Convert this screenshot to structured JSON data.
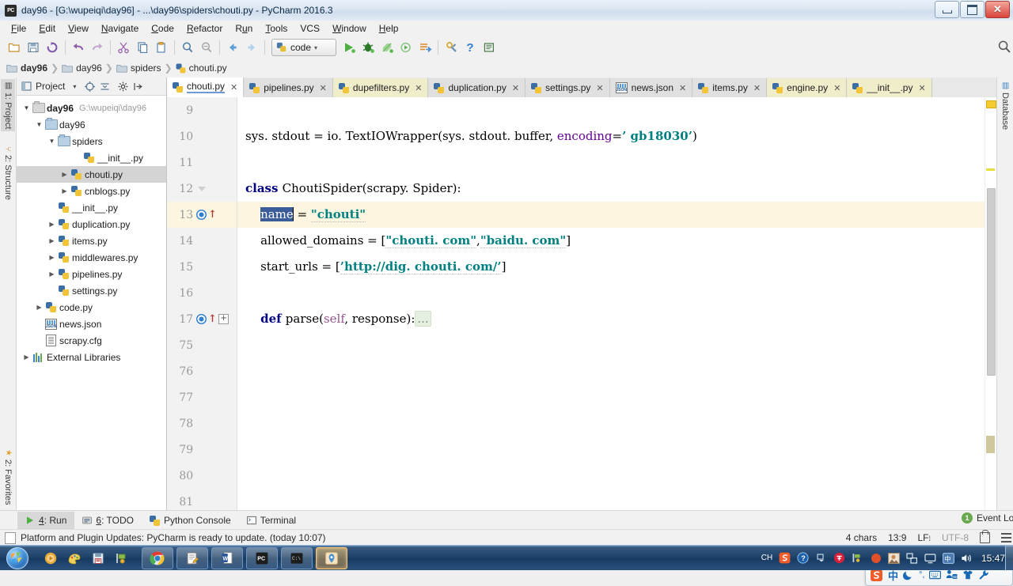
{
  "window": {
    "title": "day96 - [G:\\wupeiqi\\day96] - ...\\day96\\spiders\\chouti.py - PyCharm 2016.3",
    "app_icon": "PC",
    "minimize": "−",
    "maximize": "□",
    "close": "✕"
  },
  "menu": [
    {
      "label": "File",
      "accel": "F"
    },
    {
      "label": "Edit",
      "accel": "E"
    },
    {
      "label": "View",
      "accel": "V"
    },
    {
      "label": "Navigate",
      "accel": "N"
    },
    {
      "label": "Code",
      "accel": "C"
    },
    {
      "label": "Refactor",
      "accel": "R"
    },
    {
      "label": "Run",
      "accel": "u"
    },
    {
      "label": "Tools",
      "accel": "T"
    },
    {
      "label": "VCS",
      "accel": ""
    },
    {
      "label": "Window",
      "accel": "W"
    },
    {
      "label": "Help",
      "accel": "H"
    }
  ],
  "toolbar": {
    "run_config": "code",
    "buttons": [
      "open-folder-icon",
      "save-all-icon",
      "sync-icon",
      "undo-icon",
      "redo-icon",
      "cut-icon",
      "copy-icon",
      "paste-icon",
      "find-icon",
      "replace-icon",
      "back-icon",
      "forward-icon"
    ],
    "run_buttons": [
      "run-icon",
      "debug-icon",
      "coverage-icon",
      "profile-icon",
      "run-with-console-icon"
    ],
    "settings_label": "settings-icon",
    "help_label": "help-icon",
    "search_everywhere": "search-everywhere-icon"
  },
  "breadcrumb": [
    {
      "label": "day96",
      "icon": "folder-icon",
      "bold": true
    },
    {
      "label": "day96",
      "icon": "folder-icon",
      "bold": false
    },
    {
      "label": "spiders",
      "icon": "folder-icon",
      "bold": false
    },
    {
      "label": "chouti.py",
      "icon": "python-file-icon",
      "bold": false
    }
  ],
  "left_strip": [
    {
      "label": "1: Project",
      "accel": "1",
      "selected": true,
      "icon": "project-icon"
    },
    {
      "label": "2: Structure",
      "accel": "7",
      "selected": false,
      "icon": "structure-icon"
    },
    {
      "label": "2: Favorites",
      "accel": "2",
      "selected": false,
      "icon": "star-icon"
    }
  ],
  "right_strip": [
    {
      "label": "Database",
      "icon": "database-icon"
    }
  ],
  "project_pane": {
    "title": "Project",
    "header_icons": [
      "chevron-down-icon",
      "target-icon",
      "collapse-all-icon",
      "settings-gear-icon",
      "hide-icon"
    ],
    "tree": [
      {
        "indent": 0,
        "twisty": "open",
        "icon": "folder-icon",
        "label": "day96",
        "bold": true,
        "path": "G:\\wupeiqi\\day96",
        "selected": false
      },
      {
        "indent": 1,
        "twisty": "open",
        "icon": "folder-blue-icon",
        "label": "day96",
        "bold": false,
        "path": "",
        "selected": false
      },
      {
        "indent": 2,
        "twisty": "open",
        "icon": "folder-blue-icon",
        "label": "spiders",
        "bold": false,
        "path": "",
        "selected": false
      },
      {
        "indent": 4,
        "twisty": "none",
        "icon": "python-file-icon",
        "label": "__init__.py",
        "bold": false,
        "path": "",
        "selected": false
      },
      {
        "indent": 3,
        "twisty": "closed",
        "icon": "python-file-icon",
        "label": "chouti.py",
        "bold": false,
        "path": "",
        "selected": true
      },
      {
        "indent": 3,
        "twisty": "closed",
        "icon": "python-file-icon",
        "label": "cnblogs.py",
        "bold": false,
        "path": "",
        "selected": false
      },
      {
        "indent": 2,
        "twisty": "none",
        "icon": "python-file-icon",
        "label": "__init__.py",
        "bold": false,
        "path": "",
        "selected": false
      },
      {
        "indent": 2,
        "twisty": "closed",
        "icon": "python-file-icon",
        "label": "duplication.py",
        "bold": false,
        "path": "",
        "selected": false
      },
      {
        "indent": 2,
        "twisty": "closed",
        "icon": "python-file-icon",
        "label": "items.py",
        "bold": false,
        "path": "",
        "selected": false
      },
      {
        "indent": 2,
        "twisty": "closed",
        "icon": "python-file-icon",
        "label": "middlewares.py",
        "bold": false,
        "path": "",
        "selected": false
      },
      {
        "indent": 2,
        "twisty": "closed",
        "icon": "python-file-icon",
        "label": "pipelines.py",
        "bold": false,
        "path": "",
        "selected": false
      },
      {
        "indent": 2,
        "twisty": "none",
        "icon": "python-file-icon",
        "label": "settings.py",
        "bold": false,
        "path": "",
        "selected": false
      },
      {
        "indent": 1,
        "twisty": "closed",
        "icon": "python-file-icon",
        "label": "code.py",
        "bold": false,
        "path": "",
        "selected": false
      },
      {
        "indent": 1,
        "twisty": "none",
        "icon": "json-file-icon",
        "label": "news.json",
        "bold": false,
        "path": "",
        "selected": false
      },
      {
        "indent": 1,
        "twisty": "none",
        "icon": "cfg-file-icon",
        "label": "scrapy.cfg",
        "bold": false,
        "path": "",
        "selected": false
      },
      {
        "indent": 0,
        "twisty": "closed",
        "icon": "libraries-icon",
        "label": "External Libraries",
        "bold": false,
        "path": "",
        "selected": false
      }
    ]
  },
  "editor": {
    "tabs": [
      {
        "label": "chouti.py",
        "icon": "python-file-icon",
        "active": true,
        "modified": false
      },
      {
        "label": "pipelines.py",
        "icon": "python-file-icon",
        "active": false,
        "modified": false
      },
      {
        "label": "dupefilters.py",
        "icon": "python-file-icon",
        "active": false,
        "modified": true
      },
      {
        "label": "duplication.py",
        "icon": "python-file-icon",
        "active": false,
        "modified": false
      },
      {
        "label": "settings.py",
        "icon": "python-file-icon",
        "active": false,
        "modified": false
      },
      {
        "label": "news.json",
        "icon": "json-file-icon",
        "active": false,
        "modified": false
      },
      {
        "label": "items.py",
        "icon": "python-file-icon",
        "active": false,
        "modified": false
      },
      {
        "label": "engine.py",
        "icon": "python-file-icon",
        "active": false,
        "modified": true
      },
      {
        "label": "__init__.py",
        "icon": "python-file-icon",
        "active": false,
        "modified": true
      }
    ],
    "tab_close": "✕",
    "lines": [
      {
        "num": "9",
        "current": false,
        "override": false,
        "fold": "none",
        "tokens": []
      },
      {
        "num": "10",
        "current": false,
        "override": false,
        "fold": "none",
        "tokens": [
          {
            "t": "sys. stdout = io. TextIOWrapper(sys. stdout. buffer,",
            "c": "plain"
          },
          {
            "t": " encoding",
            "c": "named"
          },
          {
            "t": "=",
            "c": "plain"
          },
          {
            "t": "’ gb18030’",
            "c": "str"
          },
          {
            "t": ")",
            "c": "plain"
          }
        ]
      },
      {
        "num": "11",
        "current": false,
        "override": false,
        "fold": "none",
        "tokens": []
      },
      {
        "num": "12",
        "current": false,
        "override": false,
        "fold": "tri",
        "tokens": [
          {
            "t": "class ",
            "c": "kw"
          },
          {
            "t": "ChoutiSpider(scrapy. Spider):",
            "c": "plain"
          }
        ]
      },
      {
        "num": "13",
        "current": true,
        "override": true,
        "fold": "none",
        "tokens": [
          {
            "t": "    ",
            "c": "plain"
          },
          {
            "t": "name",
            "c": "sel"
          },
          {
            "t": " = ",
            "c": "plain"
          },
          {
            "t": "\"chouti\"",
            "c": "str-u"
          }
        ]
      },
      {
        "num": "14",
        "current": false,
        "override": false,
        "fold": "none",
        "tokens": [
          {
            "t": "    allowed_domains = [",
            "c": "plain"
          },
          {
            "t": "\"chouti. com\"",
            "c": "str-u"
          },
          {
            "t": ",",
            "c": "plain"
          },
          {
            "t": "\"baidu. com\"",
            "c": "str-u"
          },
          {
            "t": "]",
            "c": "plain"
          }
        ]
      },
      {
        "num": "15",
        "current": false,
        "override": false,
        "fold": "none",
        "tokens": [
          {
            "t": "    start_urls = [",
            "c": "plain"
          },
          {
            "t": "’http://dig. chouti. com/’",
            "c": "str-u"
          },
          {
            "t": "]",
            "c": "plain"
          }
        ]
      },
      {
        "num": "16",
        "current": false,
        "override": false,
        "fold": "none",
        "tokens": []
      },
      {
        "num": "17",
        "current": false,
        "override": true,
        "fold": "plus",
        "tokens": [
          {
            "t": "    ",
            "c": "plain"
          },
          {
            "t": "def ",
            "c": "kw"
          },
          {
            "t": "parse(",
            "c": "plain"
          },
          {
            "t": "self",
            "c": "selfkw"
          },
          {
            "t": ", response):",
            "c": "plain"
          },
          {
            "t": "...",
            "c": "folded"
          }
        ]
      },
      {
        "num": "75",
        "current": false,
        "override": false,
        "fold": "none",
        "tokens": []
      },
      {
        "num": "76",
        "current": false,
        "override": false,
        "fold": "none",
        "tokens": []
      },
      {
        "num": "77",
        "current": false,
        "override": false,
        "fold": "none",
        "tokens": []
      },
      {
        "num": "78",
        "current": false,
        "override": false,
        "fold": "none",
        "tokens": []
      },
      {
        "num": "79",
        "current": false,
        "override": false,
        "fold": "none",
        "tokens": []
      },
      {
        "num": "80",
        "current": false,
        "override": false,
        "fold": "none",
        "tokens": []
      },
      {
        "num": "81",
        "current": false,
        "override": false,
        "fold": "none",
        "tokens": []
      }
    ]
  },
  "ime": {
    "items": [
      "sogou-logo-icon",
      "chinese-mode-icon",
      "moon-icon",
      "punctuation-icon",
      "keyboard-icon",
      "toolbox-icon",
      "skin-icon",
      "settings-wrench-icon"
    ],
    "chinese_char": "中"
  },
  "bottom_tabs": [
    {
      "label": "4: Run",
      "accel": "4",
      "icon": "run-icon",
      "selected": true
    },
    {
      "label": "6: TODO",
      "accel": "6",
      "icon": "todo-icon",
      "selected": false
    },
    {
      "label": "Python Console",
      "accel": "",
      "icon": "python-file-icon",
      "selected": false
    },
    {
      "label": "Terminal",
      "accel": "",
      "icon": "terminal-icon",
      "selected": false
    }
  ],
  "event_log": {
    "label": "Event Log",
    "count": "1"
  },
  "statusbar": {
    "message": "Platform and Plugin Updates: PyCharm is ready to update. (today 10:07)",
    "chars": "4 chars",
    "caret": "13:9",
    "line_sep": "LF",
    "encoding": "UTF-8",
    "lock_icon": "lock-icon",
    "hidden_icon": "hidden-items-icon"
  },
  "taskbar": {
    "start": "windows-start-orb",
    "quick_launch": [
      "media-player-icon",
      "paint-icon",
      "save-icon",
      "tool-icon"
    ],
    "apps": [
      {
        "name": "chrome-icon",
        "active": false
      },
      {
        "name": "notepad-icon",
        "active": false
      },
      {
        "name": "word-icon",
        "active": false
      },
      {
        "name": "pycharm-icon",
        "active": false
      },
      {
        "name": "cmd-icon",
        "active": false
      },
      {
        "name": "launcher-icon",
        "active": true
      }
    ],
    "tray": [
      "input-mode-CH",
      "sogou-icon",
      "help-icon",
      "expand-icon",
      "antivirus-icon",
      "tool-icon",
      "record-icon",
      "photo-icon",
      "network-share-icon",
      "monitor-icon",
      "ime-icon",
      "volume-icon"
    ],
    "tray_text": "CH",
    "clock": "15:47"
  },
  "colors": {
    "accent": "#3a5d99",
    "string": "#008080",
    "keyword": "#000080",
    "current_line": "#fcf6e0",
    "modified_tab": "#f0edcb",
    "titlebar": "#dbe6f2"
  }
}
